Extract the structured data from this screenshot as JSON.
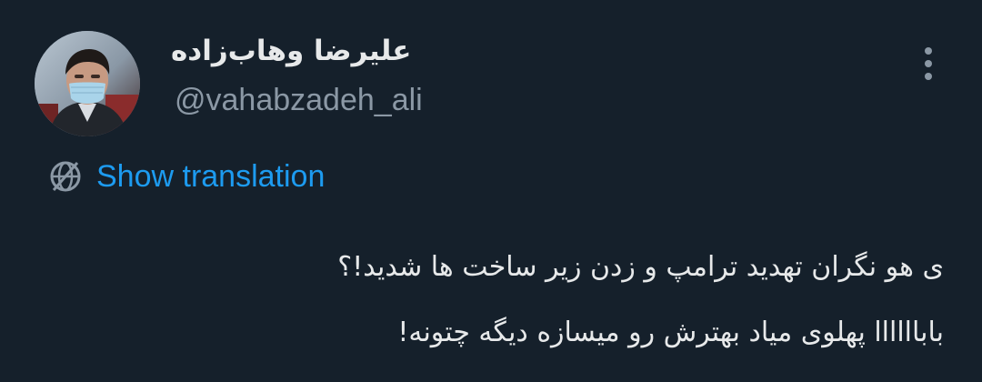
{
  "theme": {
    "background": "#15202b",
    "text_primary": "#e7e9ea",
    "text_secondary": "#8b98a5",
    "accent": "#1d9bf0"
  },
  "author": {
    "display_name": "علیرضا وهاب‌زاده",
    "handle": "@vahabzadeh_ali",
    "avatar": "profile-photo-man-wearing-blue-face-mask"
  },
  "menu": {
    "icon": "vertical-ellipsis-icon"
  },
  "translation": {
    "icon": "globe-icon",
    "label": "Show translation"
  },
  "tweet": {
    "lines": [
      "ی هو نگران تهدید ترامپ و زدن زیر ساخت ها شدید!؟",
      "باباااااا پهلوی میاد بهترش رو میسازه دیگه چتونه!"
    ]
  }
}
